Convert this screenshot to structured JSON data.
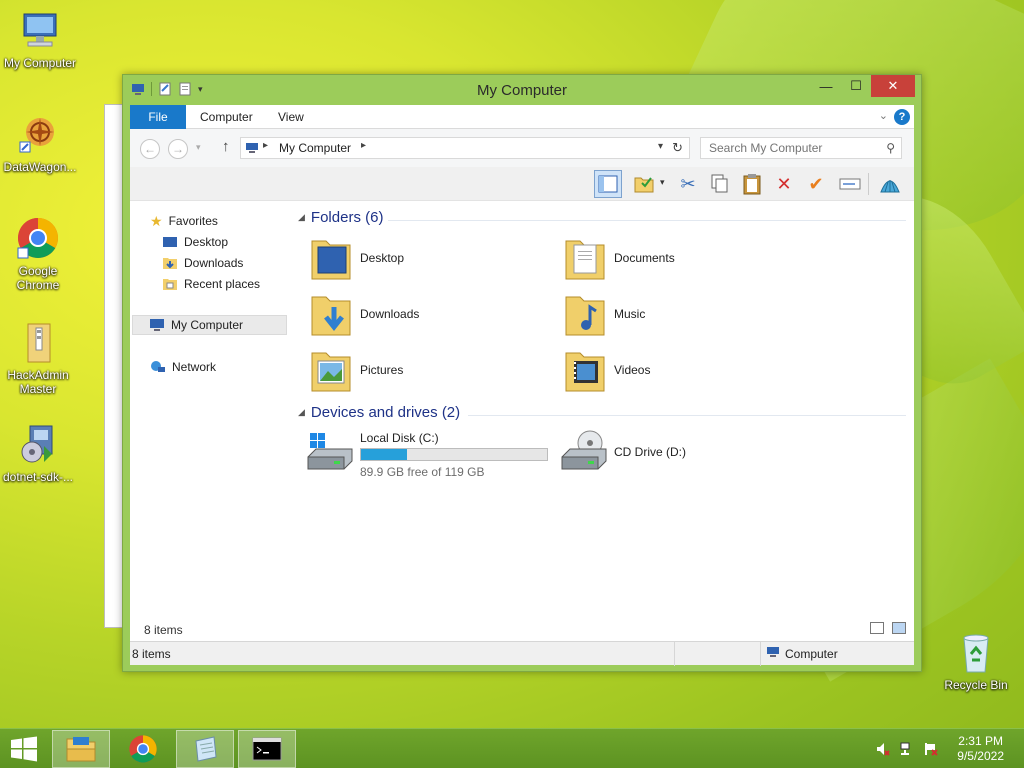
{
  "desktop": {
    "icons": [
      {
        "label": "My Computer",
        "icon": "computer-icon"
      },
      {
        "label": "DataWagon...",
        "icon": "datawagon-shortcut-icon"
      },
      {
        "label": "Google Chrome",
        "icon": "chrome-icon"
      },
      {
        "label": "HackAdmin Master",
        "icon": "folder-zip-icon"
      },
      {
        "label": "dotnet-sdk-...",
        "icon": "installer-icon"
      },
      {
        "label": "Recycle Bin",
        "icon": "recycle-bin-icon"
      }
    ]
  },
  "window": {
    "title": "My Computer",
    "controls": {
      "minimize": "—",
      "maximize": "☐",
      "close": "✕"
    },
    "ribbon": {
      "tabs": [
        {
          "label": "File",
          "active": true
        },
        {
          "label": "Computer"
        },
        {
          "label": "View"
        }
      ],
      "help": "?"
    },
    "nav": {
      "address": "My Computer",
      "search_placeholder": "Search My Computer"
    },
    "sidebar": {
      "favorites": "Favorites",
      "favorites_items": [
        "Desktop",
        "Downloads",
        "Recent places"
      ],
      "my_computer": "My Computer",
      "network": "Network"
    },
    "folders_group": {
      "header": "Folders (6)",
      "items": [
        {
          "name": "Desktop",
          "icon": "desktop-folder-icon"
        },
        {
          "name": "Documents",
          "icon": "documents-folder-icon"
        },
        {
          "name": "Downloads",
          "icon": "downloads-folder-icon"
        },
        {
          "name": "Music",
          "icon": "music-folder-icon"
        },
        {
          "name": "Pictures",
          "icon": "pictures-folder-icon"
        },
        {
          "name": "Videos",
          "icon": "videos-folder-icon"
        }
      ]
    },
    "drives_group": {
      "header": "Devices and drives (2)",
      "local_disk": {
        "name": "Local Disk (C:)",
        "free_text": "89.9 GB free of 119 GB",
        "used_fraction": 0.245
      },
      "cd_drive": {
        "name": "CD Drive (D:)"
      }
    },
    "status": {
      "items_inner": "8 items",
      "items_outer": "8 items",
      "location": "Computer"
    }
  },
  "taskbar": {
    "apps": [
      "file-explorer-icon",
      "chrome-icon",
      "notepad-icon",
      "command-prompt-icon"
    ],
    "clock": {
      "time": "2:31 PM",
      "date": "9/5/2022"
    }
  },
  "colors": {
    "accent": "#1979ca",
    "window_frame": "#9ccc5a",
    "group_header": "#1e3287",
    "drive_bar": "#26a0da",
    "close_button": "#c8413a"
  }
}
